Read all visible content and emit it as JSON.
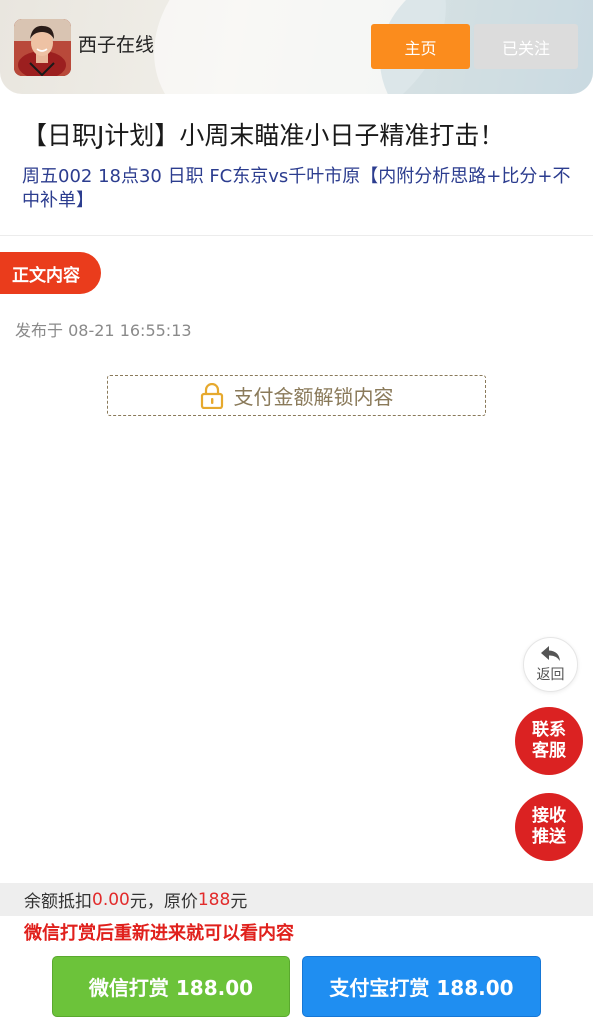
{
  "header": {
    "author_name": "西子在线",
    "home_label": "主页",
    "follow_label": "已关注"
  },
  "article": {
    "title": "【日职J计划】小周末瞄准小日子精准打击！",
    "subtitle": "周五002 18点30 日职 FC东京vs千叶市原【内附分析思路+比分+不中补单】",
    "section_tag": "正文内容",
    "publish_label": "发布于",
    "publish_time": "08-21 16:55:13",
    "unlock_label": "支付金额解锁内容"
  },
  "floating": {
    "back_label": "返回",
    "contact_label_1": "联系",
    "contact_label_2": "客服",
    "push_label_1": "接收",
    "push_label_2": "推送"
  },
  "payment": {
    "balance_prefix": "余额抵扣",
    "balance_amount": "0.00",
    "balance_unit": "元，原价",
    "original_price": "188",
    "price_unit": "元",
    "notice": "微信打赏后重新进来就可以看内容",
    "wechat_label": "微信打赏 188.00",
    "alipay_label": "支付宝打赏 188.00"
  },
  "colors": {
    "home_button": "#fb8c1d",
    "tag": "#ea3c1c",
    "float_red": "#db2222",
    "wechat": "#6cc33a",
    "alipay": "#1f8ef1"
  },
  "icons": [
    "avatar-photo",
    "lock-icon",
    "back-arrow-icon"
  ]
}
